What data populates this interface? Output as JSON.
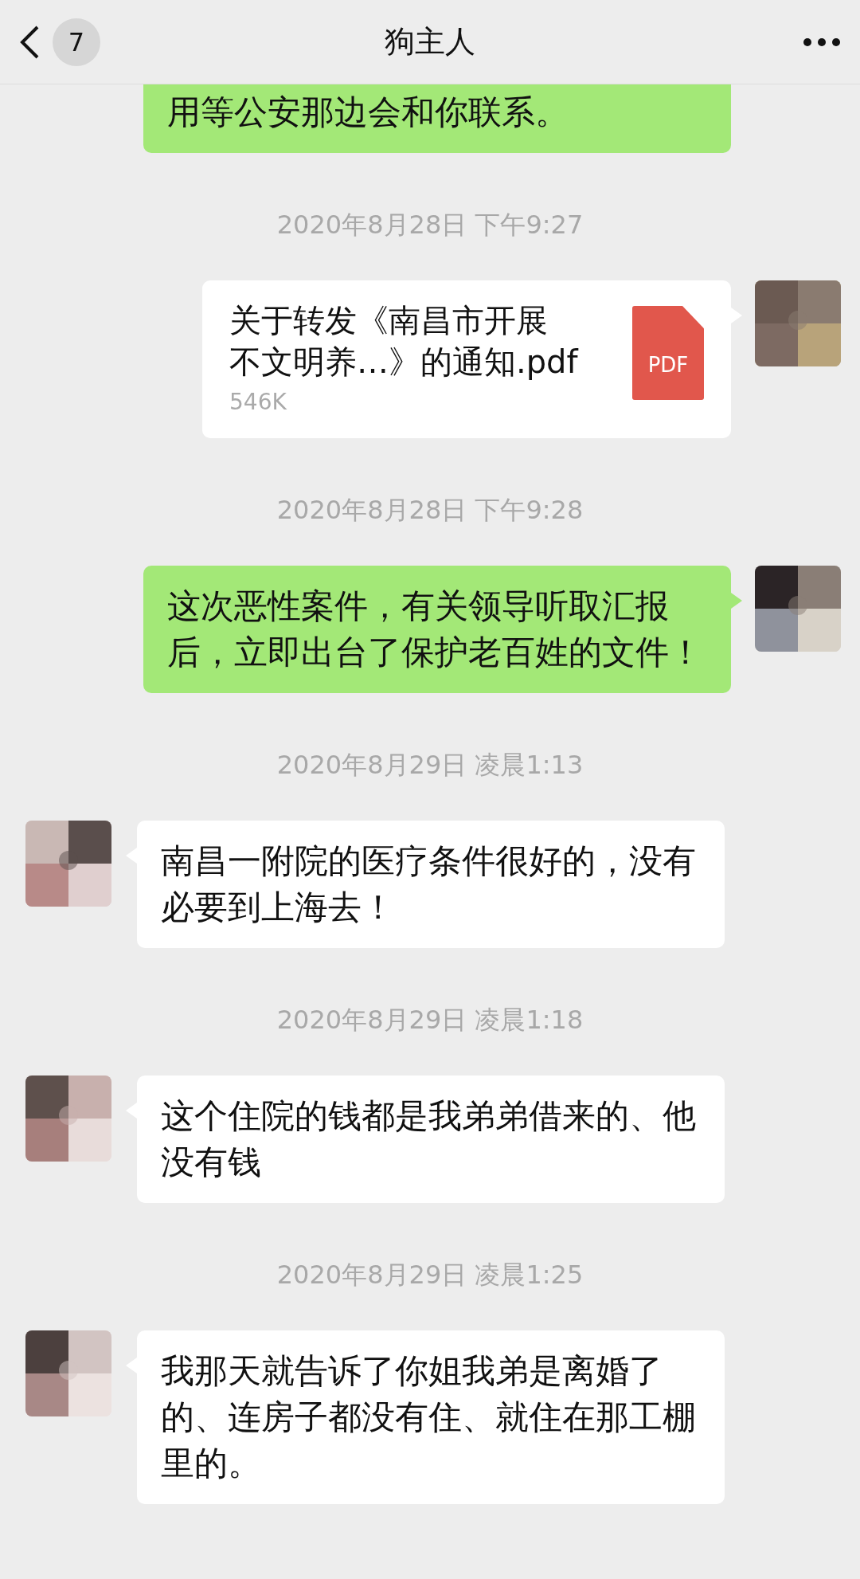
{
  "header": {
    "back_count": "7",
    "title": "狗主人"
  },
  "messages": [
    {
      "kind": "sent_text_cut",
      "text": "用等公安那边会和你联系。"
    },
    {
      "kind": "time",
      "text": "2020年8月28日 下午9:27"
    },
    {
      "kind": "sent_file",
      "name_lines": [
        "关于转发《南昌市开展",
        "不文明养…》的通知.pdf"
      ],
      "size": "546K",
      "file_type": "PDF"
    },
    {
      "kind": "time",
      "text": "2020年8月28日 下午9:28"
    },
    {
      "kind": "sent_text",
      "text": "这次恶性案件，有关领导听取汇报后，立即出台了保护老百姓的文件！"
    },
    {
      "kind": "time",
      "text": "2020年8月29日 凌晨1:13"
    },
    {
      "kind": "received_text",
      "text": "南昌一附院的医疗条件很好的，没有必要到上海去！"
    },
    {
      "kind": "time",
      "text": "2020年8月29日 凌晨1:18"
    },
    {
      "kind": "received_text",
      "text": "这个住院的钱都是我弟弟借来的、他没有钱"
    },
    {
      "kind": "time",
      "text": "2020年8月29日 凌晨1:25"
    },
    {
      "kind": "received_text",
      "text": "我那天就告诉了你姐我弟是离婚了的、连房子都没有住、就住在那工棚里的。"
    }
  ]
}
